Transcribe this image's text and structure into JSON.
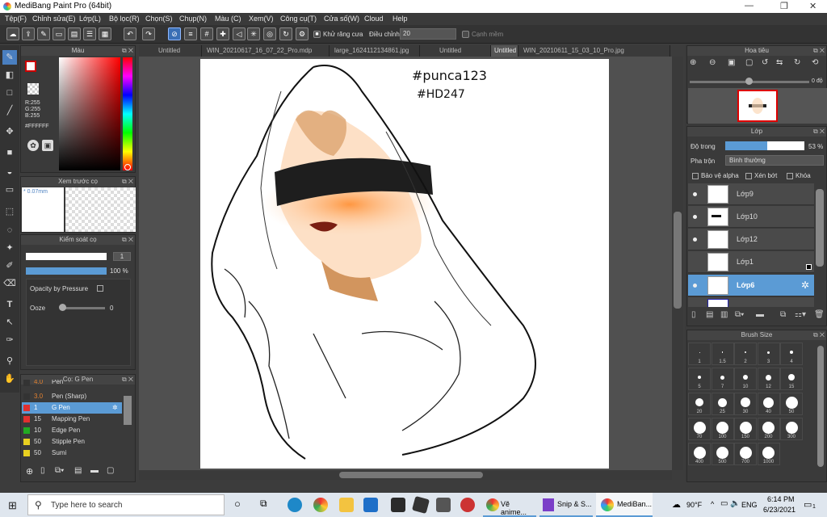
{
  "window": {
    "title": "MediBang Paint Pro (64bit)",
    "min": "—",
    "max": "❐",
    "close": "✕"
  },
  "menu": [
    "Tệp(F)",
    "Chỉnh sửa(E)",
    "Lớp(L)",
    "Bộ lọc(R)",
    "Chọn(S)",
    "Chụp(N)",
    "Màu (C)",
    "Xem(V)",
    "Công cụ(T)",
    "Cửa số(W)",
    "Cloud",
    "Help"
  ],
  "toolbar": {
    "antialias_label": "Khử răng cưa",
    "adjust_label": "Điều chỉnh",
    "adjust_value": "20",
    "snap_label": "Cạnh mềm"
  },
  "color_panel": {
    "title": "Màu",
    "r": "R:255",
    "g": "G:255",
    "b": "B:255",
    "hex": "#FFFFFF"
  },
  "brush_preview": {
    "title": "Xem trước cọ",
    "size": "0.07mm"
  },
  "brush_control": {
    "title": "Kiểm soát cọ",
    "value1": "1",
    "opacity": "100 %",
    "opacity_pressure": "Opacity by Pressure",
    "ooze_label": "Ooze",
    "ooze_value": "0"
  },
  "brush_list": {
    "title": "Cọ: G Pen",
    "items": [
      {
        "num": "4.0",
        "name": "Pen",
        "color": "#333333"
      },
      {
        "num": "3.0",
        "name": "Pen (Sharp)",
        "color": "#333333"
      },
      {
        "num": "1",
        "name": "G Pen",
        "color": "#e03030"
      },
      {
        "num": "15",
        "name": "Mapping Pen",
        "color": "#e03030"
      },
      {
        "num": "10",
        "name": "Edge Pen",
        "color": "#22aa22"
      },
      {
        "num": "50",
        "name": "Stipple Pen",
        "color": "#e8d020"
      },
      {
        "num": "50",
        "name": "Sumi",
        "color": "#e8d020"
      }
    ]
  },
  "tabs": [
    "Untitled",
    "WIN_20210617_16_07_22_Pro.mdp",
    "large_1624112134861.jpg",
    "Untitled",
    "Untitled",
    "WIN_20210611_15_03_10_Pro.jpg"
  ],
  "canvas": {
    "hashtag1": "#punca123",
    "hashtag2": "#HD247"
  },
  "navigator": {
    "title": "Hoa tiêu",
    "angle": "0 độ"
  },
  "layers_panel": {
    "title": "Lớp",
    "opacity_label": "Độ trong",
    "opacity_value": "53 %",
    "opacity_fraction": 0.53,
    "blend_label": "Pha trộn",
    "blend_value": "Bình thường",
    "protect_alpha": "Bảo vệ alpha",
    "clipping": "Xén bớt",
    "lock": "Khóa",
    "layers": [
      "Lớp9",
      "Lớp10",
      "Lớp12",
      "Lớp1",
      "Lớp6"
    ]
  },
  "brush_size": {
    "title": "Brush Size",
    "sizes": [
      "1",
      "1.5",
      "2",
      "3",
      "4",
      "5",
      "7",
      "10",
      "12",
      "15",
      "20",
      "25",
      "30",
      "40",
      "50",
      "70",
      "100",
      "150",
      "200",
      "300",
      "400",
      "500",
      "700",
      "1000"
    ]
  },
  "taskbar": {
    "search": "Type here to search",
    "app1": "Vẽ anime...",
    "app2": "Snip & S...",
    "app3": "MediBan...",
    "weather": "90°F",
    "lang": "ENG",
    "time": "6:14 PM",
    "date": "6/23/2021",
    "notif": "1"
  },
  "colors": {
    "accent": "#5b9bd5",
    "selection_blue": "#3a6fb5"
  }
}
